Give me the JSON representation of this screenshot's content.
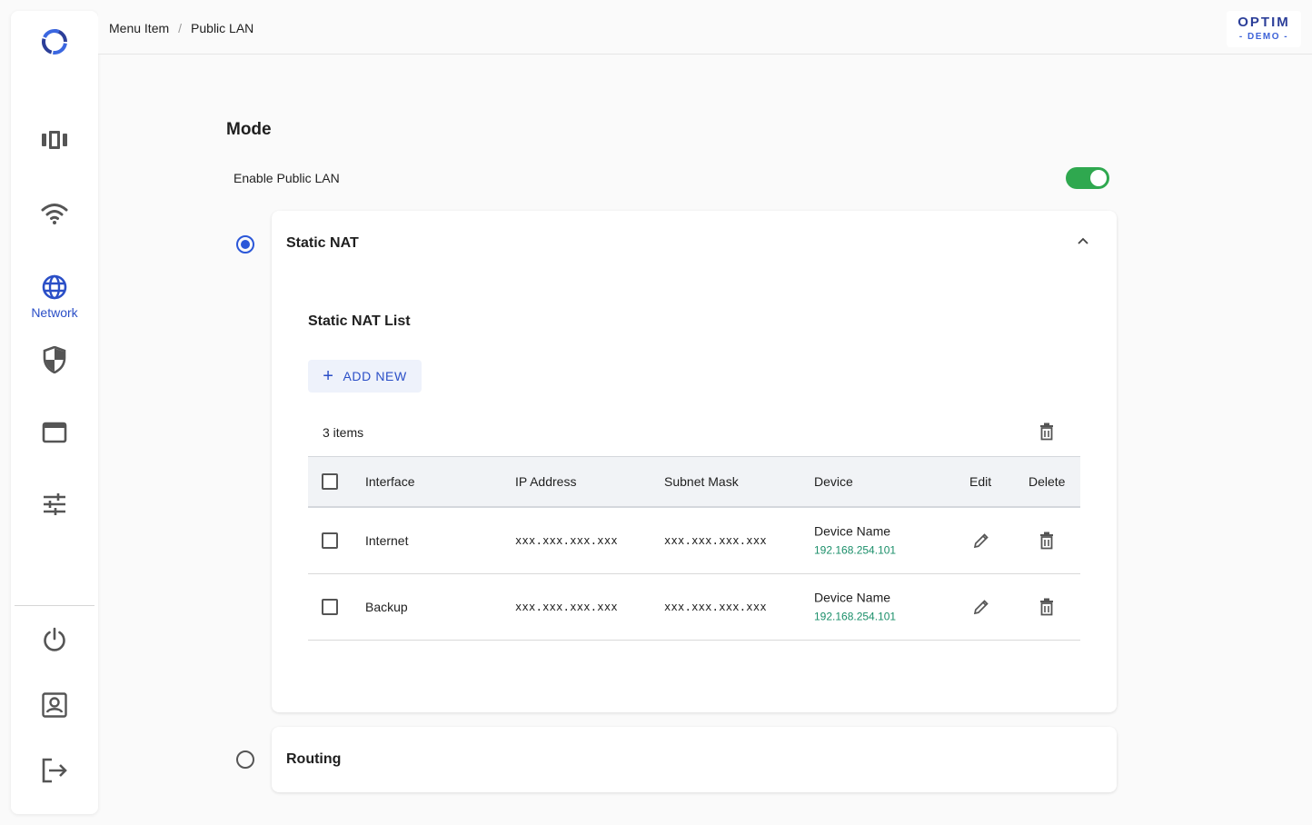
{
  "breadcrumb": {
    "parent": "Menu Item",
    "separator": "/",
    "current": "Public LAN"
  },
  "brand": {
    "name": "OPTIM",
    "tag": "- DEMO -"
  },
  "sidebar": {
    "items": [
      {
        "icon": "carousel-icon"
      },
      {
        "icon": "wifi-icon"
      },
      {
        "icon": "globe-icon",
        "label": "Network",
        "active": true
      },
      {
        "icon": "shield-icon"
      },
      {
        "icon": "window-icon"
      },
      {
        "icon": "sliders-icon"
      },
      {
        "icon": "power-icon"
      },
      {
        "icon": "account-icon"
      },
      {
        "icon": "logout-icon"
      }
    ]
  },
  "mode": {
    "title": "Mode",
    "enable_label": "Enable Public LAN",
    "enabled": true
  },
  "static_nat": {
    "title": "Static NAT",
    "selected": true,
    "expanded": true,
    "list_title": "Static NAT List",
    "add_label": "ADD NEW",
    "items_count": "3 items",
    "columns": {
      "interface": "Interface",
      "ip": "IP Address",
      "subnet": "Subnet Mask",
      "device": "Device",
      "edit": "Edit",
      "delete": "Delete"
    },
    "rows": [
      {
        "interface": "Internet",
        "ip": "xxx.xxx.xxx.xxx",
        "subnet": "xxx.xxx.xxx.xxx",
        "device_name": "Device Name",
        "device_ip": "192.168.254.101"
      },
      {
        "interface": "Backup",
        "ip": "xxx.xxx.xxx.xxx",
        "subnet": "xxx.xxx.xxx.xxx",
        "device_name": "Device Name",
        "device_ip": "192.168.254.101"
      }
    ]
  },
  "routing": {
    "title": "Routing",
    "selected": false
  },
  "colors": {
    "accent": "#2b4fc7",
    "toggle_on": "#2fa84f",
    "device_ip": "#1b8f6a"
  }
}
